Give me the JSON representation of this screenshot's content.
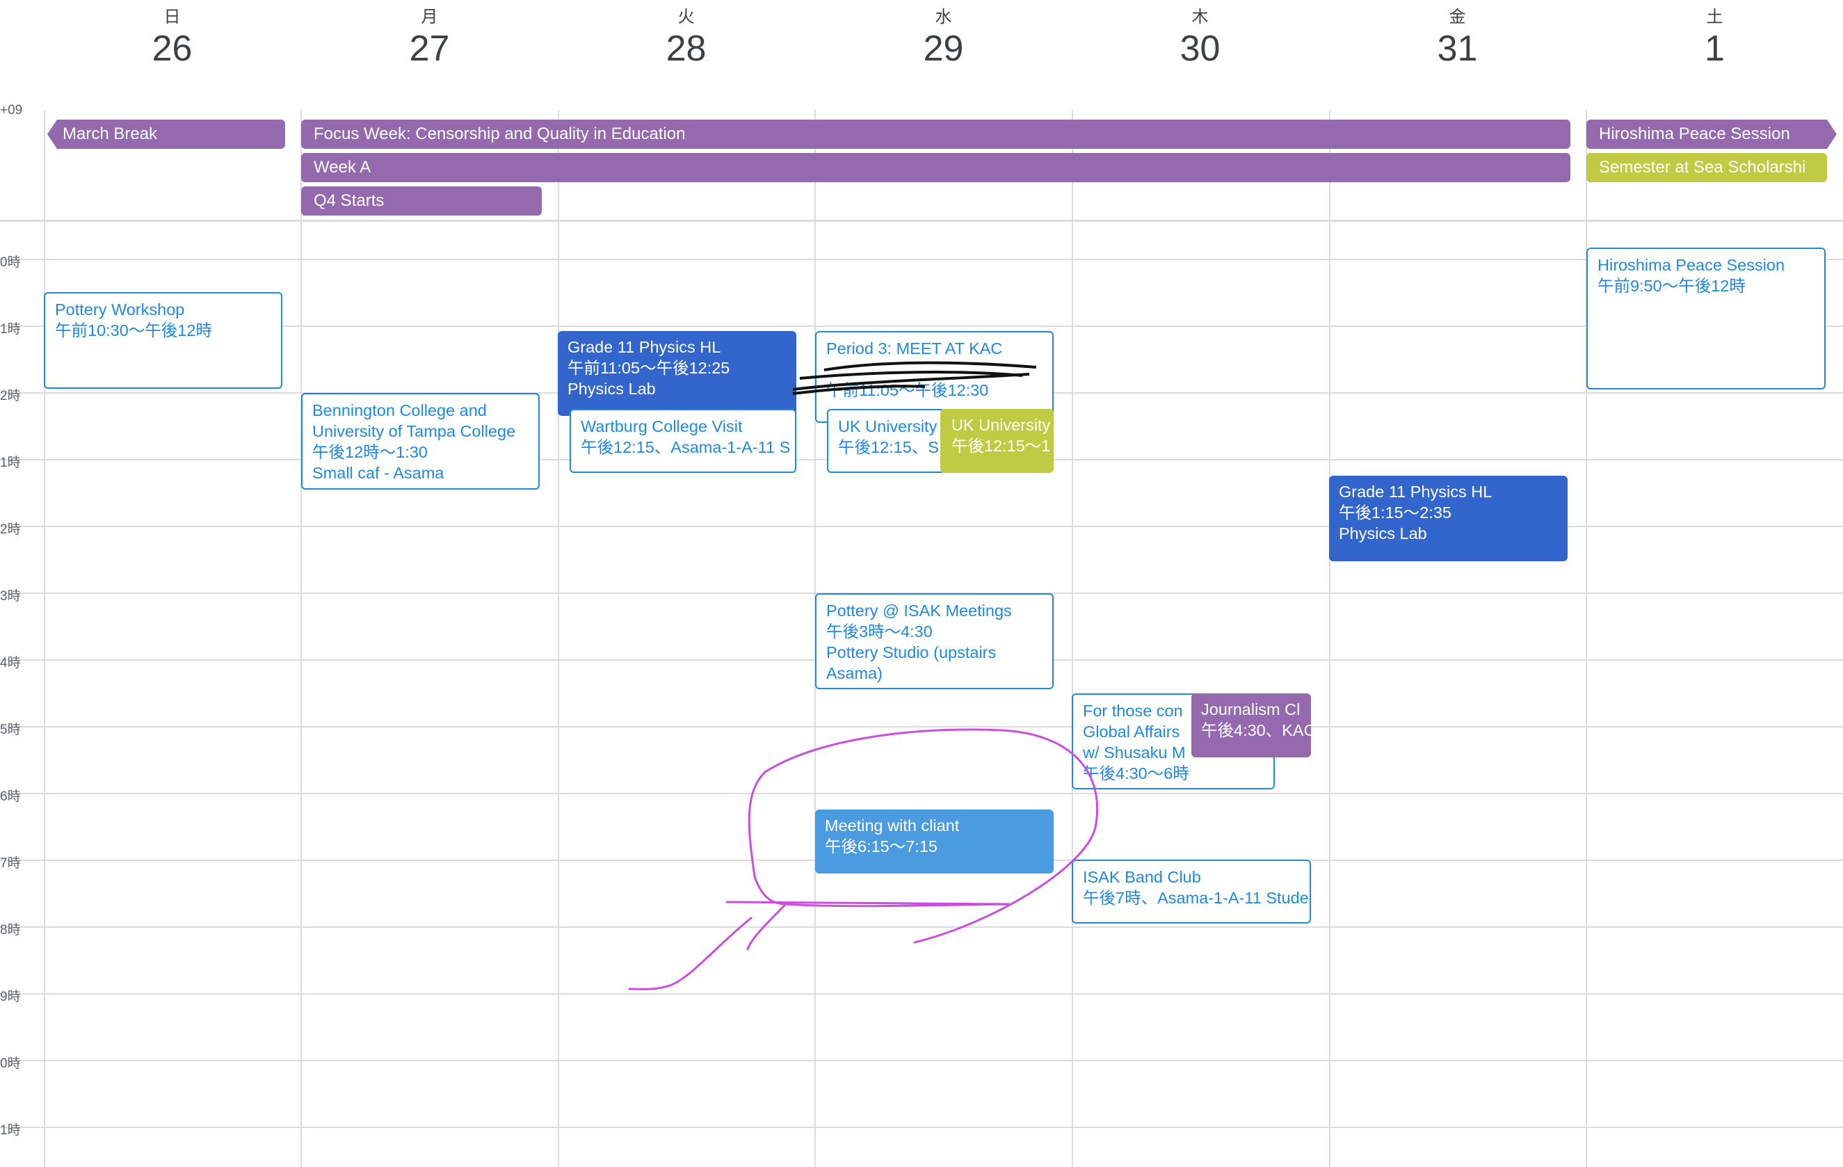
{
  "timezone_label": "+09",
  "days": [
    {
      "dow": "日",
      "date": "26"
    },
    {
      "dow": "月",
      "date": "27"
    },
    {
      "dow": "火",
      "date": "28"
    },
    {
      "dow": "水",
      "date": "29"
    },
    {
      "dow": "木",
      "date": "30"
    },
    {
      "dow": "金",
      "date": "31"
    },
    {
      "dow": "土",
      "date": "1"
    }
  ],
  "hour_labels": [
    "0時",
    "1時",
    "2時",
    "1時",
    "2時",
    "3時",
    "4時",
    "5時",
    "6時",
    "7時",
    "8時",
    "9時",
    "0時",
    "1時"
  ],
  "all_day": {
    "march_break": "March Break",
    "focus_week": "Focus Week: Censorship and Quality in Education",
    "week_a": "Week A",
    "q4_starts": "Q4 Starts",
    "hiroshima": "Hiroshima Peace Session",
    "semester_sea": "Semester at Sea Scholarshi"
  },
  "events": {
    "pottery_workshop": {
      "title": "Pottery Workshop",
      "time": "午前10:30〜午後12時"
    },
    "bennington": {
      "line1": "Bennington College and",
      "line2": "University of Tampa College",
      "time": "午後12時〜1:30",
      "location": "Small caf - Asama"
    },
    "physics_tue": {
      "title": "Grade 11 Physics HL",
      "time": "午前11:05〜午後12:25",
      "location": "Physics Lab"
    },
    "wartburg": {
      "title": "Wartburg College Visit",
      "time": "午後12:15、Asama-1-A-11 S"
    },
    "period3": {
      "title": "Period 3: MEET AT KAC",
      "time": "午前11:05〜午後12:30"
    },
    "uk_univ_1": {
      "title": "UK University",
      "time": "午後12:15、S"
    },
    "uk_univ_2": {
      "title": "UK University",
      "time": "午後12:15〜1"
    },
    "physics_fri": {
      "title": "Grade 11 Physics HL",
      "time": "午後1:15〜2:35",
      "location": "Physics Lab"
    },
    "pottery_isak": {
      "title": "Pottery @ ISAK Meetings",
      "time": "午後3時〜4:30",
      "loc1": "Pottery Studio (upstairs",
      "loc2": "Asama)"
    },
    "global_affairs": {
      "line1": "For those con",
      "line2": "Global Affairs",
      "line3": "w/ Shusaku M",
      "time": "午後4:30〜6時"
    },
    "journalism": {
      "title": "Journalism Cl",
      "time": "午後4:30、KAC"
    },
    "meeting": {
      "title": "Meeting with cliant",
      "time": "午後6:15〜7:15"
    },
    "band": {
      "title": "ISAK Band Club",
      "time": "午後7時、Asama-1-A-11 Stude"
    },
    "hiroshima_sat": {
      "title": "Hiroshima Peace Session",
      "time": "午前9:50〜午後12時"
    }
  },
  "colors": {
    "purple": "#9469ad",
    "olive": "#c0ca43",
    "blue": "#3366cc",
    "outline_blue": "#1e88e5",
    "ink": "#c94ee0"
  }
}
